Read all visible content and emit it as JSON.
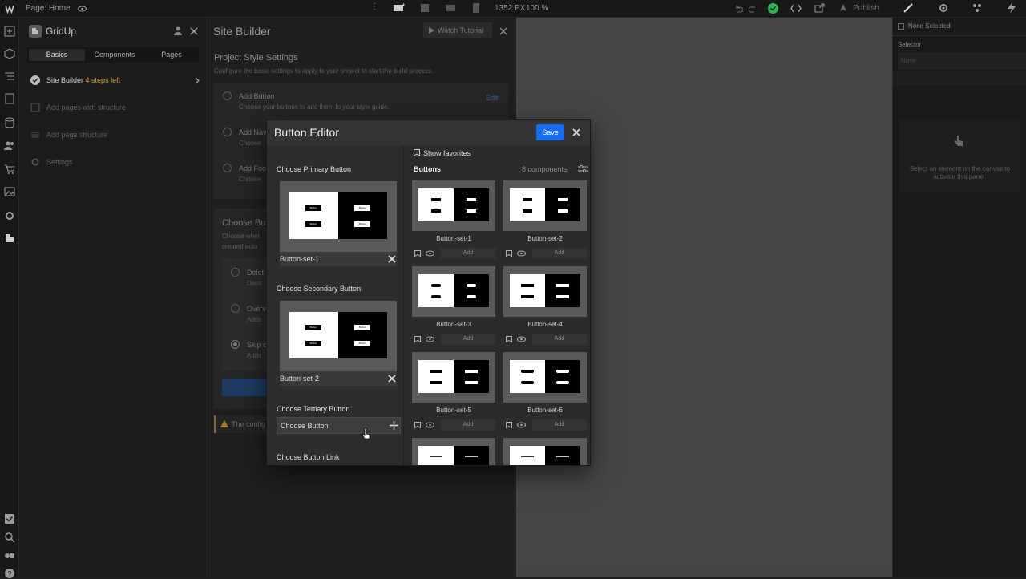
{
  "topbar": {
    "page_label": "Page: Home",
    "width": "1352 PX",
    "zoom": "100 %",
    "publish": "Publish"
  },
  "gridup": {
    "title": "GridUp",
    "tabs": [
      "Basics",
      "Components",
      "Pages"
    ],
    "items": [
      {
        "label": "Site Builder",
        "badge": "4 steps left"
      },
      {
        "label": "Add pages with structure"
      },
      {
        "label": "Add page structure"
      },
      {
        "label": "Settings"
      }
    ]
  },
  "site_builder": {
    "title": "Site Builder",
    "watch_tutorial": "Watch Tutorial",
    "section_title": "Project Style Settings",
    "section_desc": "Configure the basic settings to apply to your project to start the build process.",
    "add_button_title": "Add Button",
    "add_button_desc": "Choose your buttons to add them to your style guide.",
    "edit": "Edit",
    "add_nav": "Add Nav",
    "add_nav_desc": "Choose",
    "add_footer": "Add Foo",
    "add_footer_desc": "Choose",
    "choose_build": "Choose Bui",
    "choose_build_desc1": "Choose whet",
    "choose_build_desc2": "created auto",
    "opt1": "Delet",
    "opt1_desc": "Delet",
    "opt2": "Overv",
    "opt2_desc": "Adds",
    "opt3": "Skip c",
    "opt3_desc": "Adds",
    "warning": "The config"
  },
  "right_panel": {
    "none_selected": "None Selected",
    "selector": "Selector",
    "selector_value": "None",
    "hint": "Select an element on the canvas to activate this panel."
  },
  "modal": {
    "title": "Button Editor",
    "save": "Save",
    "primary_label": "Choose Primary Button",
    "primary_value": "Button-set-1",
    "secondary_label": "Choose Secondary Button",
    "secondary_value": "Button-set-2",
    "tertiary_label": "Choose Tertiary Button",
    "tertiary_placeholder": "Choose Button",
    "link_label": "Choose Button Link",
    "mini_button": "Button",
    "show_favorites": "Show favorites",
    "buttons_heading": "Buttons",
    "count": "8 components",
    "add": "Add",
    "cards": [
      "Button-set-1",
      "Button-set-2",
      "Button-set-3",
      "Button-set-4",
      "Button-set-5",
      "Button-set-6"
    ]
  },
  "colors": {
    "accent": "#146ef5",
    "warning": "#f5a623",
    "success": "#2fb455"
  }
}
